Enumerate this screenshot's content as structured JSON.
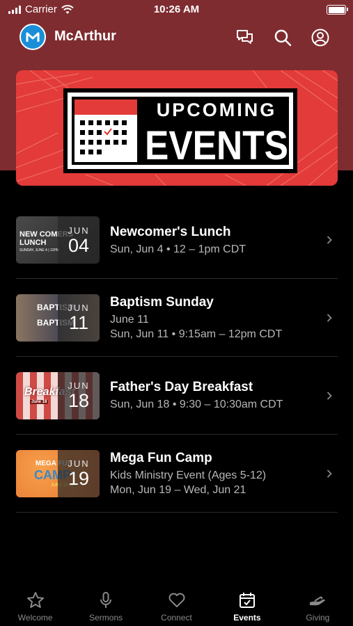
{
  "status_bar": {
    "carrier": "Carrier",
    "time": "10:26 AM"
  },
  "header": {
    "title": "McArthur",
    "icons": [
      "chat-icon",
      "search-icon",
      "profile-icon"
    ]
  },
  "banner": {
    "line1": "UPCOMING",
    "line2": "EVENTS"
  },
  "events": [
    {
      "title": "Newcomer's Lunch",
      "lines": [
        "Sun, Jun 4 • 12 – 1pm CDT"
      ],
      "month": "JUN",
      "day": "04",
      "thumb_text": [
        "NEW COMERS",
        "LUNCH",
        "SUNDAY, JUNE 4 | 12PM"
      ]
    },
    {
      "title": "Baptism Sunday",
      "lines": [
        "June 11",
        "Sun, Jun 11 • 9:15am – 12pm CDT"
      ],
      "month": "JUN",
      "day": "11",
      "thumb_text": [
        "BAPTISM",
        "BAPTISM"
      ]
    },
    {
      "title": "Father's Day Breakfast",
      "lines": [
        "Sun, Jun 18 • 9:30 – 10:30am CDT"
      ],
      "month": "JUN",
      "day": "18",
      "thumb_text": [
        "Breakfast",
        "June 18"
      ]
    },
    {
      "title": "Mega Fun Camp",
      "lines": [
        "Kids Ministry Event (Ages 5-12)",
        "Mon, Jun 19 – Wed, Jun 21"
      ],
      "month": "JUN",
      "day": "19",
      "thumb_text": [
        "MEGA FUN",
        "CAMP",
        "JUNE 19-21"
      ]
    }
  ],
  "tabs": [
    {
      "label": "Welcome",
      "icon": "star-icon"
    },
    {
      "label": "Sermons",
      "icon": "microphone-icon"
    },
    {
      "label": "Connect",
      "icon": "heart-icon"
    },
    {
      "label": "Events",
      "icon": "calendar-icon",
      "active": true
    },
    {
      "label": "Giving",
      "icon": "giving-hand-icon"
    }
  ],
  "colors": {
    "header_bg": "#7e2c30",
    "banner_red": "#e23b39",
    "logo_blue": "#1a8fd8",
    "muted_text": "#b8b8b8",
    "tab_inactive": "#8a8a8a"
  }
}
